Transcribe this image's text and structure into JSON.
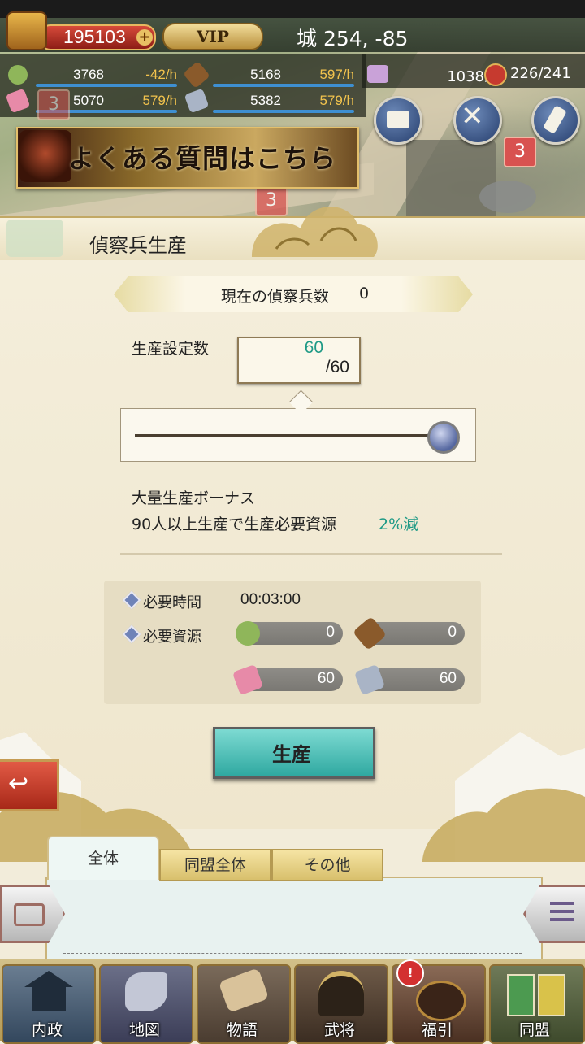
{
  "header": {
    "gold": "195103",
    "gold_plus": "+",
    "vip": "VIP",
    "coords": "城 254, -85"
  },
  "resources": [
    {
      "name": "food",
      "icon": "rice-icon",
      "value": "3768",
      "rate": "-42/h"
    },
    {
      "name": "wood",
      "icon": "wood-log-icon",
      "value": "5168",
      "rate": "597/h"
    },
    {
      "name": "cloth",
      "icon": "cloth-icon",
      "value": "5070",
      "rate": "579/h"
    },
    {
      "name": "iron",
      "icon": "iron-ingot-icon",
      "value": "5382",
      "rate": "579/h"
    }
  ],
  "population": {
    "value": "1038人"
  },
  "food_supply": {
    "value": "226/241"
  },
  "round_buttons": [
    {
      "name": "mail",
      "icon": "mail-icon"
    },
    {
      "name": "battle",
      "icon": "crossed-swords-icon"
    },
    {
      "name": "quest",
      "icon": "scroll-icon"
    }
  ],
  "badges": [
    "3",
    "3",
    "3"
  ],
  "faq_banner": {
    "text": "よくある質問はこちら"
  },
  "title": "偵察兵生産",
  "current_count": {
    "label": "現在の偵察兵数",
    "value": "0"
  },
  "production": {
    "label": "生産設定数",
    "current": "60",
    "max": "/60",
    "slider_fraction": 1.0
  },
  "bonus": {
    "title": "大量生産ボーナス",
    "text": "90人以上生産で生産必要資源",
    "percent": "2%減"
  },
  "requirements": {
    "time_label": "必要時間",
    "time_value": "00:03:00",
    "resource_label": "必要資源",
    "costs": [
      {
        "icon": "rice-icon",
        "value": "0"
      },
      {
        "icon": "wood-log-icon",
        "value": "0"
      },
      {
        "icon": "cloth-icon",
        "value": "60"
      },
      {
        "icon": "iron-ingot-icon",
        "value": "60"
      }
    ]
  },
  "produce_button": "生産",
  "chat": {
    "tabs": [
      "全体",
      "同盟全体",
      "その他"
    ]
  },
  "nav": [
    {
      "label": "内政",
      "icon": "castle-icon"
    },
    {
      "label": "地図",
      "icon": "map-icon"
    },
    {
      "label": "物語",
      "icon": "scroll-stack-icon"
    },
    {
      "label": "武将",
      "icon": "helmet-icon"
    },
    {
      "label": "福引",
      "icon": "lottery-drum-icon"
    },
    {
      "label": "同盟",
      "icon": "banner-flag-icon"
    }
  ],
  "alert_mark": "!",
  "colors": {
    "accent_teal": "#1f9a86",
    "rate_gold": "#f1c24d",
    "produce_button": "#2ea8a0"
  }
}
